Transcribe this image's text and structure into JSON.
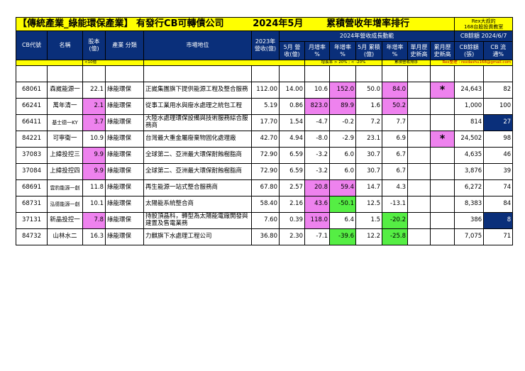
{
  "title": {
    "main": "【傳統產業_綠能環保產業】 有發行CB可轉債公司",
    "period": "2024年5月",
    "subject": "累積營收年增率排行",
    "author_line1": "Rex大叔的",
    "author_line2": "168台股投資教室"
  },
  "header": {
    "cb_code": "CB代號",
    "name": "名稱",
    "capital": "股本 (億)",
    "category": "產業 分類",
    "market_position": "市場地位",
    "revenue_2023": "2023年 營收(億)",
    "growth_group": "2024年營收成長動能",
    "cb_balance_group": "CB餘額 2024/6/7",
    "may_revenue": "5月 營收(億)",
    "mom": "月增率 %",
    "yoy": "年增率 %",
    "may_cumulative": "5月 累積(億)",
    "cum_yoy": "年增率 %",
    "single_month_high": "單月歷 史新高",
    "cumulative_high": "累月歷 史新高",
    "cb_amount": "CB餘額 (張)",
    "cb_circulation": "CB 流通%"
  },
  "legend": {
    "capital_note": "<10億",
    "growth_note": "增長率 > 20% ; < -20%",
    "cum_note": "累積營收排序",
    "credit": "Rex整理 : rexdashu168@gmail.com"
  },
  "rows": [
    {
      "code": "68061",
      "name": "森崴能源一",
      "capital": "22.1",
      "category": "綠能環保",
      "position": "正崴集團旗下提供能源工程及整合服務",
      "rev2023": "112.00",
      "may_rev": "14.00",
      "mom": "10.6",
      "yoy": "152.0",
      "cum": "50.0",
      "cum_yoy": "84.0",
      "month_high": "",
      "cum_high": "*",
      "cb_amount": "24,643",
      "cb_pct": "82"
    },
    {
      "code": "66241",
      "name": "萬年清一",
      "capital": "2.1",
      "category": "綠能環保",
      "position": "從事工業用水與廢水處理之統包工程",
      "rev2023": "5.19",
      "may_rev": "0.86",
      "mom": "823.0",
      "yoy": "89.9",
      "cum": "1.6",
      "cum_yoy": "50.2",
      "month_high": "",
      "cum_high": "",
      "cb_amount": "1,000",
      "cb_pct": "100"
    },
    {
      "code": "66411",
      "name": "基士德一KY",
      "capital": "3.7",
      "category": "綠能環保",
      "position": "大陸水處理環保設備與技術服務綜合服務商",
      "rev2023": "17.70",
      "may_rev": "1.54",
      "mom": "-4.7",
      "yoy": "-0.2",
      "cum": "7.2",
      "cum_yoy": "7.7",
      "month_high": "",
      "cum_high": "",
      "cb_amount": "814",
      "cb_pct": "27"
    },
    {
      "code": "84221",
      "name": "可寧衛一",
      "capital": "10.9",
      "category": "綠能環保",
      "position": "台灣最大重金屬廢棄物固化處理廠",
      "rev2023": "42.70",
      "may_rev": "4.94",
      "mom": "-8.0",
      "yoy": "-2.9",
      "cum": "23.1",
      "cum_yoy": "6.9",
      "month_high": "",
      "cum_high": "*",
      "cb_amount": "24,502",
      "cb_pct": "98"
    },
    {
      "code": "37083",
      "name": "上緯投控三",
      "capital": "9.9",
      "category": "綠能環保",
      "position": "全球第二、亞洲最大環保耐蝕樹脂商",
      "rev2023": "72.90",
      "may_rev": "6.59",
      "mom": "-3.2",
      "yoy": "6.0",
      "cum": "30.7",
      "cum_yoy": "6.7",
      "month_high": "",
      "cum_high": "",
      "cb_amount": "4,635",
      "cb_pct": "46"
    },
    {
      "code": "37084",
      "name": "上緯投控四",
      "capital": "9.9",
      "category": "綠能環保",
      "position": "全球第二、亞洲最大環保耐蝕樹脂商",
      "rev2023": "72.90",
      "may_rev": "6.59",
      "mom": "-3.2",
      "yoy": "6.0",
      "cum": "30.7",
      "cum_yoy": "6.7",
      "month_high": "",
      "cum_high": "",
      "cb_amount": "3,876",
      "cb_pct": "39"
    },
    {
      "code": "68691",
      "name": "雲豹能源一創",
      "capital": "11.8",
      "category": "綠能環保",
      "position": "再生能源一站式整合服務商",
      "rev2023": "67.80",
      "may_rev": "2.57",
      "mom": "20.8",
      "yoy": "59.4",
      "cum": "14.7",
      "cum_yoy": "4.3",
      "month_high": "",
      "cum_high": "",
      "cb_amount": "6,272",
      "cb_pct": "74"
    },
    {
      "code": "68731",
      "name": "泓德能源一創",
      "capital": "10.1",
      "category": "綠能環保",
      "position": "太陽能系統整合商",
      "rev2023": "58.40",
      "may_rev": "2.16",
      "mom": "43.6",
      "yoy": "-50.1",
      "cum": "12.5",
      "cum_yoy": "-13.1",
      "month_high": "",
      "cum_high": "",
      "cb_amount": "8,383",
      "cb_pct": "84"
    },
    {
      "code": "37131",
      "name": "新晶投控一",
      "capital": "7.8",
      "category": "綠能環保",
      "position": "持股頂晶科，轉型為太陽能電廠開發與建置及售電業務",
      "rev2023": "7.60",
      "may_rev": "0.39",
      "mom": "118.0",
      "yoy": "6.4",
      "cum": "1.5",
      "cum_yoy": "-20.2",
      "month_high": "",
      "cum_high": "",
      "cb_amount": "386",
      "cb_pct": "8"
    },
    {
      "code": "84732",
      "name": "山林水二",
      "capital": "16.3",
      "category": "綠能環保",
      "position": "力麒旗下水處理工程公司",
      "rev2023": "36.80",
      "may_rev": "2.30",
      "mom": "-7.1",
      "yoy": "-39.6",
      "cum": "12.2",
      "cum_yoy": "-25.8",
      "month_high": "",
      "cum_high": "",
      "cb_amount": "7,075",
      "cb_pct": "71"
    }
  ],
  "colors": {
    "title_bg": "#ffff00",
    "header_bg": "#0a2f7a",
    "high_growth": "#ee82ee",
    "low_growth": "#55ee44",
    "low_circulation": "#0a2f7a"
  }
}
